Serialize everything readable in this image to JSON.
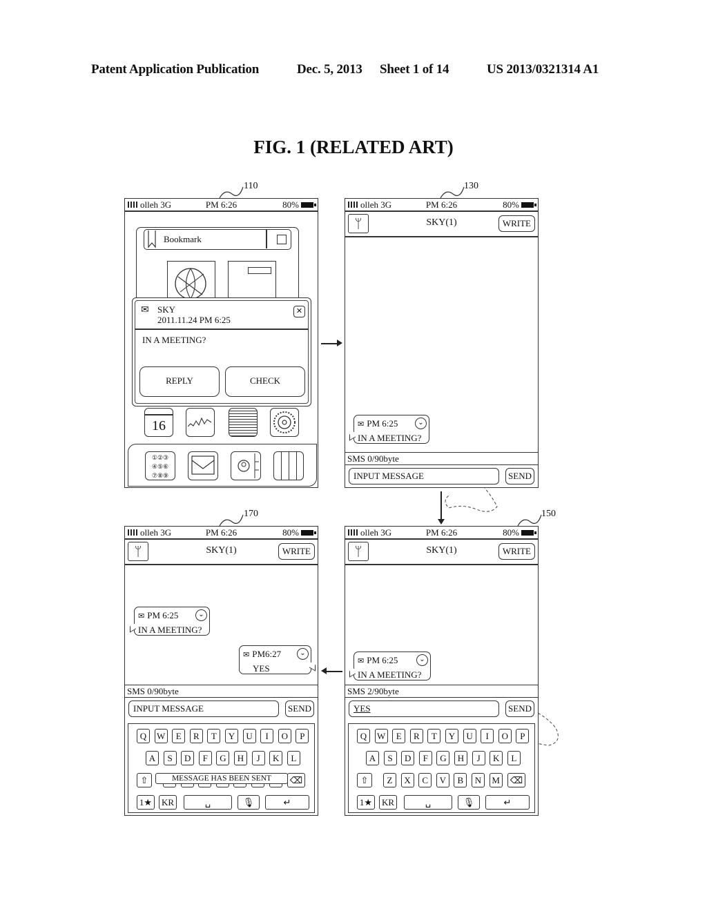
{
  "header": {
    "publication": "Patent Application Publication",
    "date": "Dec. 5, 2013",
    "sheet": "Sheet 1 of 14",
    "number": "US 2013/0321314 A1"
  },
  "figure": {
    "title": "FIG. 1 (RELATED ART)"
  },
  "status_bar": {
    "carrier": "olleh 3G",
    "time": "PM 6:26",
    "battery": "80%"
  },
  "screens": {
    "s110": {
      "ref": "110",
      "bookmark_label": "Bookmark",
      "popup": {
        "sender": "SKY",
        "datetime": "2011.11.24 PM 6:25",
        "message": "IN A MEETING?",
        "reply_label": "REPLY",
        "check_label": "CHECK"
      },
      "calendar_day": "16",
      "dialpad_digits": [
        "1",
        "2",
        "3",
        "4",
        "5",
        "6",
        "7",
        "8",
        "9"
      ]
    },
    "s130": {
      "ref": "130",
      "title": "SKY(1)",
      "write_label": "WRITE",
      "bubble": {
        "time": "PM 6:25",
        "text": "IN A MEETING?"
      },
      "sms_counter": "SMS 0/90byte",
      "input_placeholder": "INPUT MESSAGE",
      "send_label": "SEND"
    },
    "s150": {
      "ref": "150",
      "title": "SKY(1)",
      "write_label": "WRITE",
      "bubble": {
        "time": "PM 6:25",
        "text": "IN A MEETING?"
      },
      "sms_counter": "SMS 2/90byte",
      "input_value": "YES",
      "send_label": "SEND"
    },
    "s170": {
      "ref": "170",
      "title": "SKY(1)",
      "write_label": "WRITE",
      "bubble_in": {
        "time": "PM 6:25",
        "text": "IN A MEETING?"
      },
      "bubble_out": {
        "time": "PM6:27",
        "text": "YES"
      },
      "sms_counter": "SMS 0/90byte",
      "input_placeholder": "INPUT MESSAGE",
      "send_label": "SEND",
      "toast": "MESSAGE HAS BEEN SENT"
    }
  },
  "keyboard": {
    "row1": [
      "Q",
      "W",
      "E",
      "R",
      "T",
      "Y",
      "U",
      "I",
      "O",
      "P"
    ],
    "row2": [
      "A",
      "S",
      "D",
      "F",
      "G",
      "H",
      "J",
      "K",
      "L"
    ],
    "row3": [
      "Z",
      "X",
      "C",
      "V",
      "B",
      "N",
      "M"
    ],
    "shift": "⇧",
    "backspace": "⌫",
    "symbols": "1★",
    "lang": "KR",
    "space": "␣",
    "mic": "🎙",
    "enter": "↵"
  }
}
